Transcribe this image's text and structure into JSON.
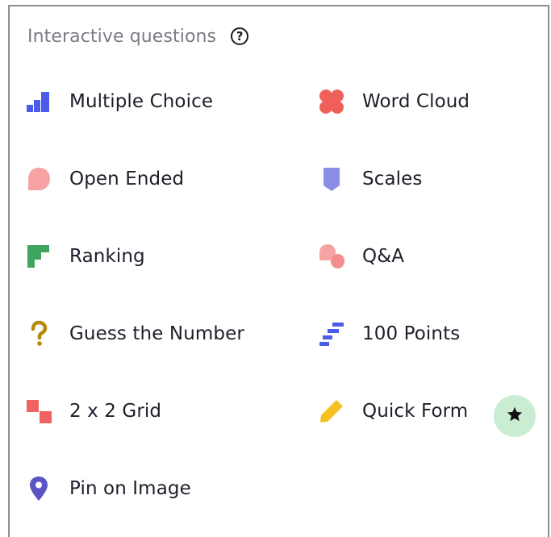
{
  "panel": {
    "title": "Interactive questions",
    "help_icon": "question-circle-icon",
    "help_glyph": "?"
  },
  "items": [
    {
      "label": "Multiple Choice",
      "icon": "bar-chart-icon",
      "color": "#4a5ce8"
    },
    {
      "label": "Word Cloud",
      "icon": "word-cloud-icon",
      "color": "#f0605a"
    },
    {
      "label": "Open Ended",
      "icon": "speech-bubble-icon",
      "color": "#f7a3a3"
    },
    {
      "label": "Scales",
      "icon": "scales-icon",
      "color": "#8a8ee6"
    },
    {
      "label": "Ranking",
      "icon": "ranking-icon",
      "color": "#3fa55e"
    },
    {
      "label": "Q&A",
      "icon": "qa-bubbles-icon",
      "color": "#f48d8d"
    },
    {
      "label": "Guess the Number",
      "icon": "question-mark-icon",
      "color": "#b58a0a"
    },
    {
      "label": "100 Points",
      "icon": "points-steps-icon",
      "color": "#4a5ce8"
    },
    {
      "label": "2 x 2 Grid",
      "icon": "grid-squares-icon",
      "color": "#f06262"
    },
    {
      "label": "Quick Form",
      "icon": "pencil-icon",
      "color": "#f5c020"
    },
    {
      "label": "Pin on Image",
      "icon": "map-pin-icon",
      "color": "#5a55c4"
    }
  ],
  "premium_badge": {
    "icon": "star-icon",
    "background": "#c9ecd2"
  }
}
